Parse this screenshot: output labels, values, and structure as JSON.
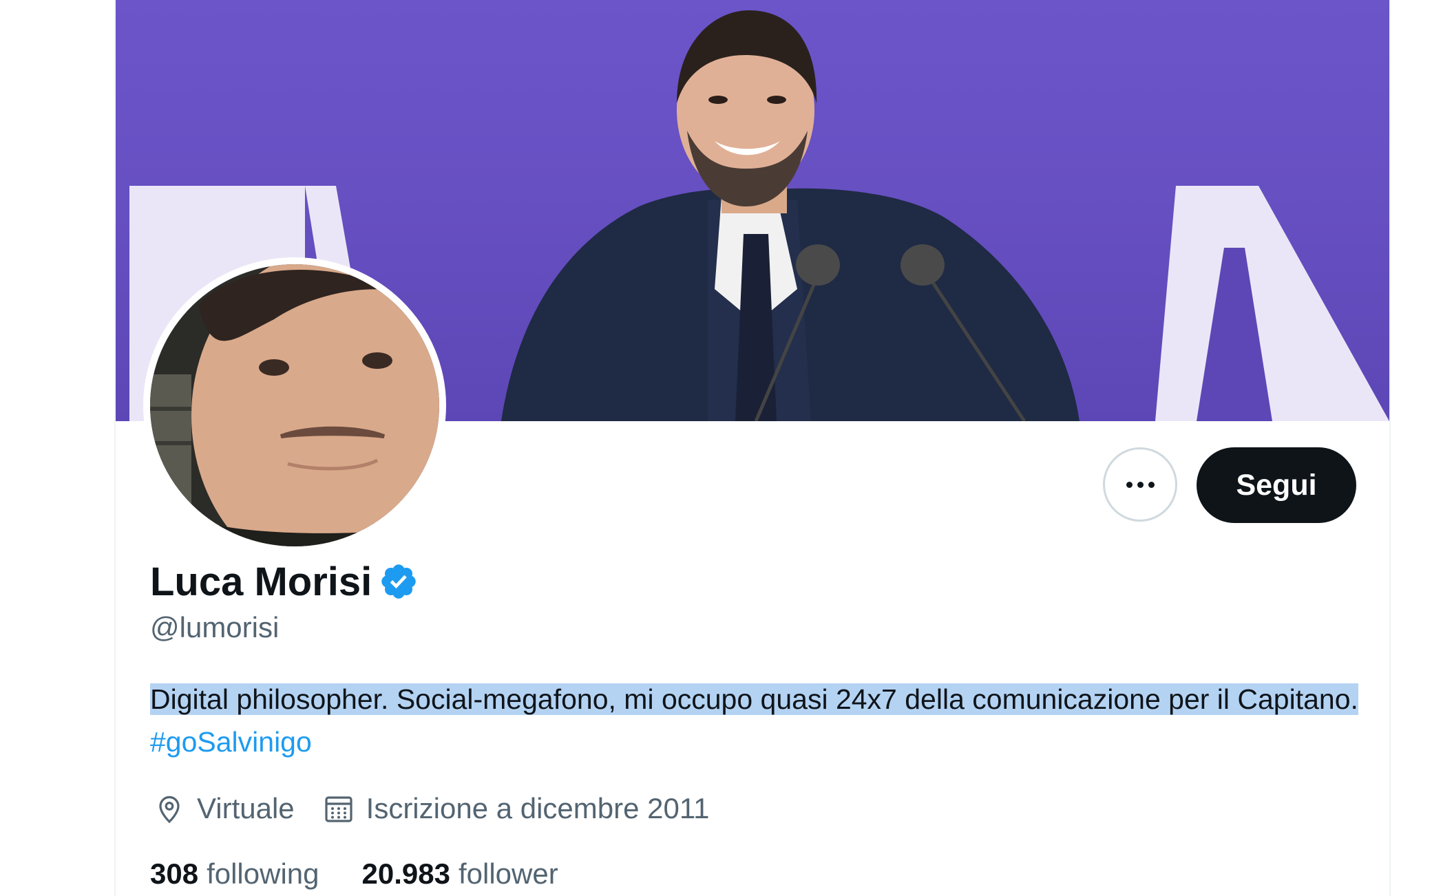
{
  "profile": {
    "display_name": "Luca Morisi",
    "handle": "@lumorisi",
    "bio_selected": "Digital philosopher. Social-megafono, mi occupo quasi 24x7 della comunicazione per il Capitano.",
    "bio_hashtag": "#goSalvinigo",
    "location": "Virtuale",
    "joined": "Iscrizione a dicembre 2011",
    "following_count": "308",
    "following_label": "following",
    "followers_count": "20.983",
    "followers_label": "follower"
  },
  "actions": {
    "follow_label": "Segui"
  },
  "icons": {
    "more": "more-options-icon",
    "verified": "verified-badge-icon",
    "location": "location-pin-icon",
    "calendar": "calendar-icon"
  },
  "colors": {
    "banner": "#6750c2",
    "accent": "#1d9bf0",
    "text": "#0f1419",
    "muted": "#536471",
    "selection": "#b4d3f3"
  }
}
